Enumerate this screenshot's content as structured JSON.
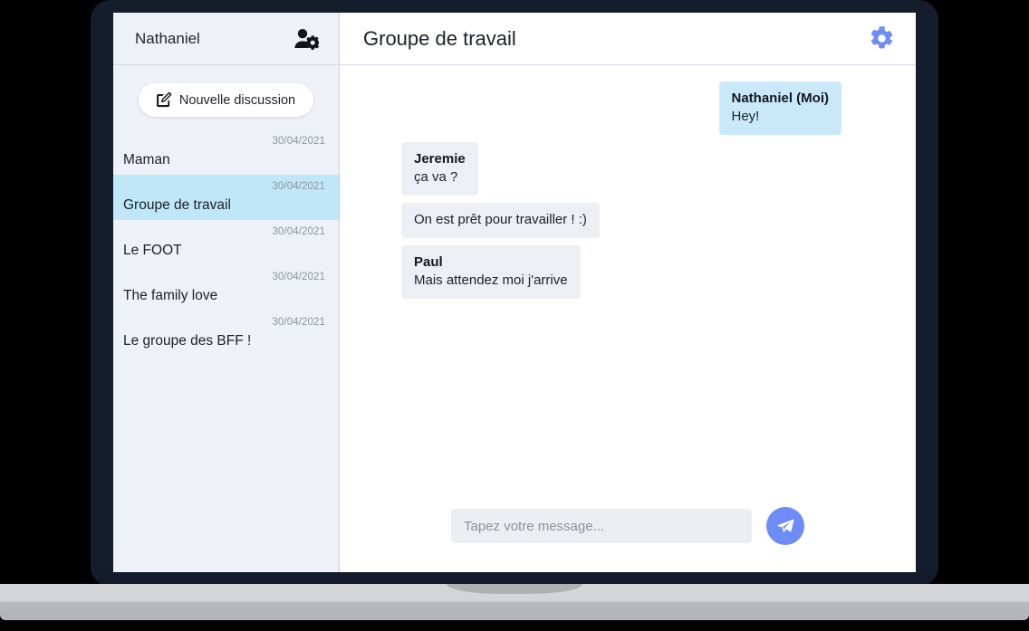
{
  "sidebar": {
    "user_name": "Nathaniel",
    "user_settings_icon": "user-cog-icon",
    "new_chat_button": {
      "label": "Nouvelle discussion",
      "icon": "pen-square-icon"
    },
    "conversations": [
      {
        "name": "Maman",
        "date": "30/04/2021",
        "selected": false
      },
      {
        "name": "Groupe de travail",
        "date": "30/04/2021",
        "selected": true
      },
      {
        "name": "Le FOOT",
        "date": "30/04/2021",
        "selected": false
      },
      {
        "name": "The family love",
        "date": "30/04/2021",
        "selected": false
      },
      {
        "name": "Le groupe des BFF !",
        "date": "30/04/2021",
        "selected": false
      }
    ]
  },
  "chat": {
    "title": "Groupe de travail",
    "settings_icon": "gear-icon",
    "messages": [
      {
        "author": "Nathaniel (Moi)",
        "text": "Hey!",
        "direction": "out"
      },
      {
        "author": "Jeremie",
        "text": "ça va ?",
        "direction": "in"
      },
      {
        "author": "",
        "text": "On est prêt pour travailler ! :)",
        "direction": "in"
      },
      {
        "author": "Paul",
        "text": "Mais attendez moi j'arrive",
        "direction": "in"
      }
    ]
  },
  "composer": {
    "placeholder": "Tapez votre message...",
    "value": "",
    "send_icon": "paper-plane-icon"
  },
  "colors": {
    "accent_blue": "#6d8cf5",
    "selected_conversation": "#bfe7f7",
    "outgoing_bubble": "#c9e9fa",
    "incoming_bubble": "#eceff4",
    "sidebar_bg": "#eef1f7",
    "laptop_bezel": "#151c2c",
    "page_bg": "#000000"
  }
}
